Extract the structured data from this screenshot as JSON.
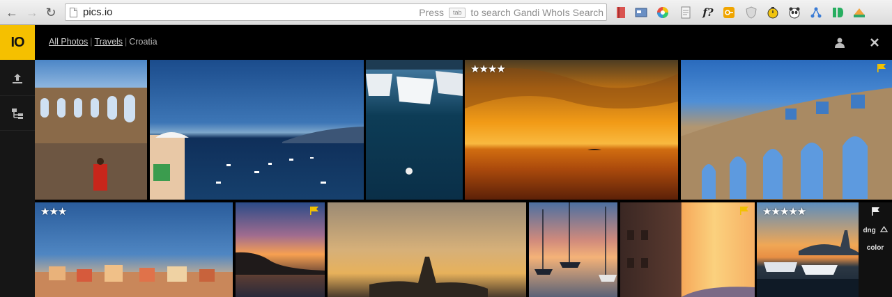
{
  "browser": {
    "url": "pics.io",
    "hint_prefix": "Press",
    "hint_key": "tab",
    "hint_suffix": "to search Gandi WhoIs Search",
    "extensions": [
      "bookmark-icon",
      "card-icon",
      "color-wheel-icon",
      "document-icon",
      "f-question-icon",
      "key-icon",
      "shield-icon",
      "stopwatch-icon",
      "panda-icon",
      "network-icon",
      "id-icon",
      "drive-icon"
    ]
  },
  "app": {
    "logo_text": "IO",
    "breadcrumb": {
      "items": [
        "All Photos",
        "Travels",
        "Croatia"
      ],
      "separator": "|"
    }
  },
  "photos": [
    {
      "id": "arena-interior",
      "stars": "",
      "flag": false
    },
    {
      "id": "harbor-bay",
      "stars": "",
      "flag": false
    },
    {
      "id": "boats-dock",
      "stars": "",
      "flag": false
    },
    {
      "id": "sunset-sea",
      "stars": "★★★★",
      "flag": false
    },
    {
      "id": "arena-exterior",
      "stars": "",
      "flag": true
    },
    {
      "id": "coastal-town",
      "stars": "★★★",
      "flag": false
    },
    {
      "id": "pink-sunset",
      "stars": "",
      "flag": true
    },
    {
      "id": "church-silhouette",
      "stars": "",
      "flag": false
    },
    {
      "id": "sailboats-sunset",
      "stars": "",
      "flag": false
    },
    {
      "id": "street-sunset",
      "stars": "",
      "flag": true
    },
    {
      "id": "rovinj-harbor",
      "stars": "★★★★★",
      "flag": false
    }
  ],
  "panel": {
    "dng_label": "dng",
    "color_label": "color"
  },
  "colors": {
    "accent": "#f5c000",
    "flag": "#f2c100"
  }
}
